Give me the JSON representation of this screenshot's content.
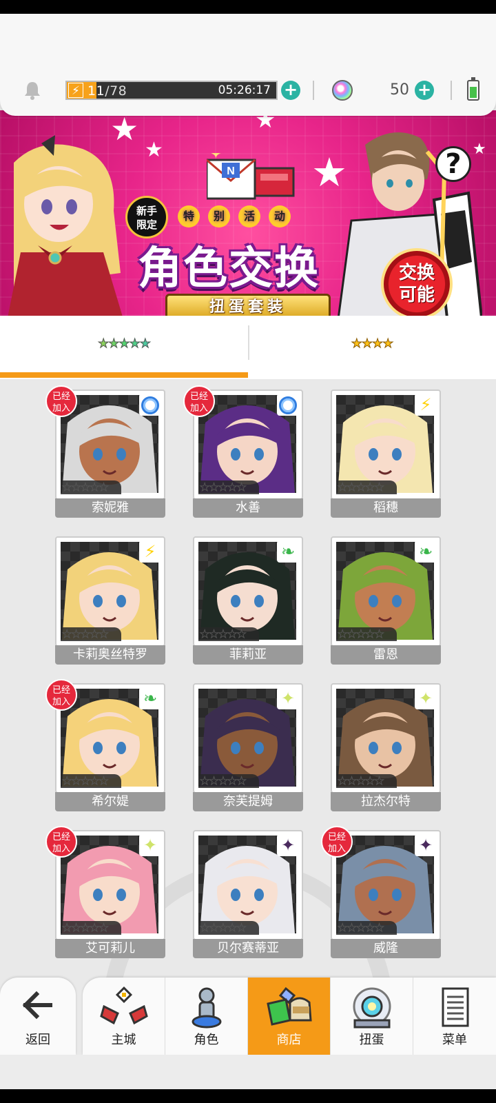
{
  "header": {
    "stamina_current": "11",
    "stamina_max": "/78",
    "stamina_fraction": 0.14,
    "stamina_timer": "05:26:17",
    "gems": "50",
    "battery_level": 0.6
  },
  "banner": {
    "new_badge": [
      "新手",
      "限定"
    ],
    "event_chars": [
      "特",
      "别",
      "活",
      "动"
    ],
    "title": "角色交换",
    "subtitle": "扭蛋套装",
    "stamp": [
      "交换",
      "可能"
    ],
    "help": "?"
  },
  "tabs": [
    {
      "stars": "★★★★★",
      "active": true
    },
    {
      "stars": "★★★★",
      "active": false
    }
  ],
  "characters": [
    {
      "name": "索妮雅",
      "joined": true,
      "attribute": "water",
      "skin": "#b9744e",
      "hair": "#d9d9d9"
    },
    {
      "name": "水善",
      "joined": true,
      "attribute": "water",
      "skin": "#f5d6c6",
      "hair": "#5b2d86"
    },
    {
      "name": "稻穗",
      "joined": false,
      "attribute": "thunder",
      "skin": "#f8dccb",
      "hair": "#f4e6b0"
    },
    {
      "name": "卡莉奥丝特罗",
      "joined": false,
      "attribute": "thunder",
      "skin": "#f8dccb",
      "hair": "#f2d27a"
    },
    {
      "name": "菲莉亚",
      "joined": false,
      "attribute": "wind",
      "skin": "#f5ddd0",
      "hair": "#1f2a24"
    },
    {
      "name": "雷恩",
      "joined": false,
      "attribute": "wind",
      "skin": "#c27e52",
      "hair": "#7da63a"
    },
    {
      "name": "希尔媞",
      "joined": true,
      "attribute": "wind",
      "skin": "#f8dccb",
      "hair": "#f5d27a"
    },
    {
      "name": "奈芙提姆",
      "joined": false,
      "attribute": "light",
      "skin": "#8a5a3a",
      "hair": "#3b2d4f"
    },
    {
      "name": "拉杰尔特",
      "joined": false,
      "attribute": "light",
      "skin": "#e8c2a4",
      "hair": "#7a5a40"
    },
    {
      "name": "艾可莉儿",
      "joined": true,
      "attribute": "light",
      "skin": "#f8dccb",
      "hair": "#f29bb0"
    },
    {
      "name": "贝尔赛蒂亚",
      "joined": false,
      "attribute": "dark",
      "skin": "#f8e0d2",
      "hair": "#e9e9ee"
    },
    {
      "name": "威隆",
      "joined": true,
      "attribute": "dark",
      "skin": "#b07050",
      "hair": "#7a8fa8"
    }
  ],
  "joined_label": [
    "已经",
    "加入"
  ],
  "nav": {
    "back": "返回",
    "items": [
      {
        "label": "主城",
        "icon": "castle-icon",
        "active": false
      },
      {
        "label": "角色",
        "icon": "character-icon",
        "active": false
      },
      {
        "label": "商店",
        "icon": "shop-icon",
        "active": true
      },
      {
        "label": "扭蛋",
        "icon": "gacha-icon",
        "active": false
      },
      {
        "label": "菜单",
        "icon": "menu-list-icon",
        "active": false
      }
    ]
  }
}
